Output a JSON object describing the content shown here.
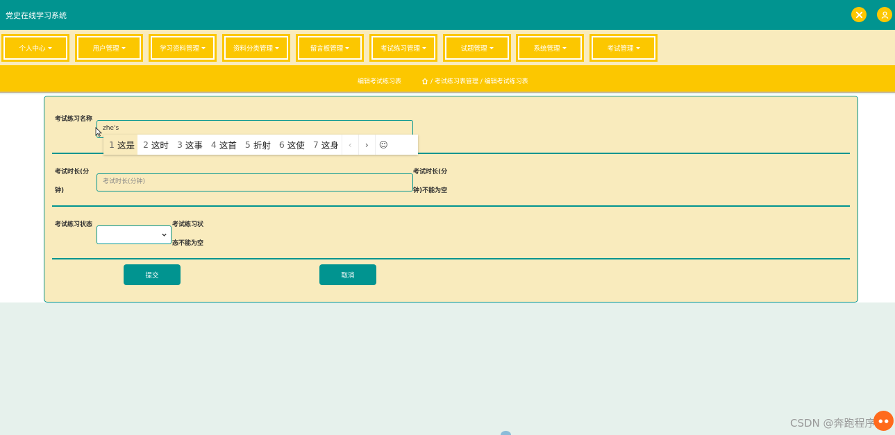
{
  "app": {
    "title": "党史在线学习系统"
  },
  "header": {
    "close_icon": "close-x-icon",
    "user_icon": "user-icon"
  },
  "nav": {
    "items": [
      {
        "label": "个人中心"
      },
      {
        "label": "用户管理"
      },
      {
        "label": "学习资料管理"
      },
      {
        "label": "资料分类管理"
      },
      {
        "label": "留言板管理"
      },
      {
        "label": "考试练习管理"
      },
      {
        "label": "试题管理"
      },
      {
        "label": "系统管理"
      },
      {
        "label": "考试管理"
      }
    ]
  },
  "subheader": {
    "title": "编辑考试练习表",
    "breadcrumb": "/ 考试练习表管理 / 编辑考试练习表"
  },
  "form": {
    "name": {
      "label": "考试练习名称",
      "value": "zhe's"
    },
    "duration": {
      "label": "考试时长(分钟)",
      "placeholder": "考试时长(分钟)",
      "hint": "考试时长(分钟)不能为空"
    },
    "status": {
      "label": "考试练习状态",
      "value": "",
      "hint": "考试练习状态不能为空"
    },
    "submit_label": "提交",
    "cancel_label": "取消"
  },
  "ime": {
    "candidates": [
      {
        "num": "1",
        "text": "这是"
      },
      {
        "num": "2",
        "text": "这时"
      },
      {
        "num": "3",
        "text": "这事"
      },
      {
        "num": "4",
        "text": "这首"
      },
      {
        "num": "5",
        "text": "折射"
      },
      {
        "num": "6",
        "text": "这使"
      },
      {
        "num": "7",
        "text": "这身"
      }
    ],
    "prev": "‹",
    "next": "›",
    "emoji": "☺"
  },
  "watermark": "CSDN @奔跑程序",
  "colors": {
    "primary": "#019490",
    "accent": "#fcc700",
    "panel": "#f9ebbd"
  }
}
